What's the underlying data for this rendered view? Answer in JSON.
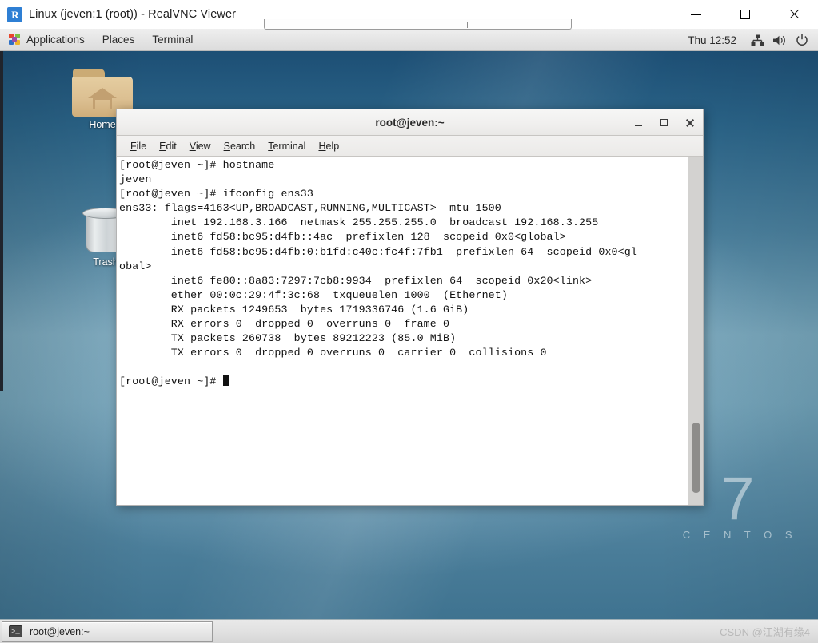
{
  "vnc_window": {
    "title": "Linux (jeven:1 (root)) - RealVNC Viewer",
    "app_icon": "realvnc-icon",
    "minimize_label": "–",
    "maximize_label": "□",
    "close_label": "✕"
  },
  "gnome_panel": {
    "applications_label": "Applications",
    "places_label": "Places",
    "terminal_label": "Terminal",
    "clock": "Thu 12:52",
    "tray": [
      "network-icon",
      "volume-icon",
      "power-icon"
    ]
  },
  "desktop": {
    "icons": [
      {
        "name": "home-folder",
        "label": "Home"
      },
      {
        "name": "trash",
        "label": "Trash"
      }
    ],
    "watermark": {
      "number": "7",
      "word": "C E N T O S"
    },
    "background_colors": {
      "top": "#1d4f75",
      "mid": "#74a3b8",
      "bottom": "#3f7390"
    }
  },
  "terminal": {
    "title": "root@jeven:~",
    "menu": [
      {
        "mnemonic": "F",
        "rest": "ile"
      },
      {
        "mnemonic": "E",
        "rest": "dit"
      },
      {
        "mnemonic": "V",
        "rest": "iew"
      },
      {
        "mnemonic": "S",
        "rest": "earch"
      },
      {
        "mnemonic": "T",
        "rest": "erminal"
      },
      {
        "mnemonic": "H",
        "rest": "elp"
      }
    ],
    "window_buttons": {
      "minimize": "minimize-icon",
      "maximize": "maximize-icon",
      "close": "close-icon"
    },
    "content": "[root@jeven ~]# hostname\njeven\n[root@jeven ~]# ifconfig ens33\nens33: flags=4163<UP,BROADCAST,RUNNING,MULTICAST>  mtu 1500\n        inet 192.168.3.166  netmask 255.255.255.0  broadcast 192.168.3.255\n        inet6 fd58:bc95:d4fb::4ac  prefixlen 128  scopeid 0x0<global>\n        inet6 fd58:bc95:d4fb:0:b1fd:c40c:fc4f:7fb1  prefixlen 64  scopeid 0x0<gl\nobal>\n        inet6 fe80::8a83:7297:7cb8:9934  prefixlen 64  scopeid 0x20<link>\n        ether 00:0c:29:4f:3c:68  txqueuelen 1000  (Ethernet)\n        RX packets 1249653  bytes 1719336746 (1.6 GiB)\n        RX errors 0  dropped 0  overruns 0  frame 0\n        TX packets 260738  bytes 89212223 (85.0 MiB)\n        TX errors 0  dropped 0 overruns 0  carrier 0  collisions 0\n\n",
    "prompt": "[root@jeven ~]# "
  },
  "taskbar": {
    "window_button_label": "root@jeven:~",
    "window_button_icon": "terminal-icon"
  },
  "watermark": {
    "text": "CSDN @江湖有缘4"
  }
}
